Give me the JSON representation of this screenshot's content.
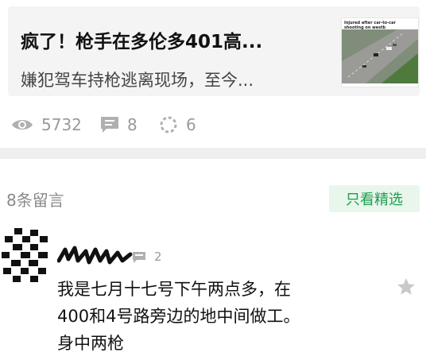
{
  "article": {
    "title": "疯了！枪手在多伦多401高...",
    "summary": "嫌犯驾车持枪逃离现场，至今...",
    "thumbnail_caption": "Injured after car-to-car shooting on westb"
  },
  "stats": {
    "views": "5732",
    "comments": "8",
    "shares": "6"
  },
  "comments_section": {
    "count_label": "8条留言",
    "featured_button": "只看精选"
  },
  "comment": {
    "reply_count": "2",
    "text_lines": [
      "我是七月十七号下午两点多，在",
      "400和4号路旁边的地中间做工。",
      "身中两枪"
    ]
  },
  "colors": {
    "accent_green": "#1e9e50",
    "featured_bg": "#e8f6ec",
    "muted_icon": "#b0b0b0"
  }
}
